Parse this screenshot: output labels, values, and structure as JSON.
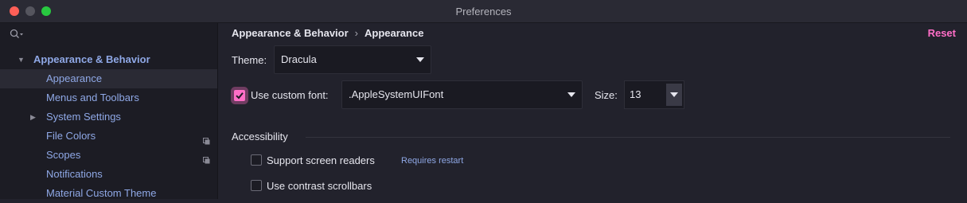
{
  "window": {
    "title": "Preferences"
  },
  "sidebar": {
    "search_placeholder": "",
    "items": [
      {
        "label": "Appearance & Behavior",
        "expanded": true
      },
      {
        "label": "Appearance",
        "selected": true
      },
      {
        "label": "Menus and Toolbars"
      },
      {
        "label": "System Settings",
        "collapsed": true
      },
      {
        "label": "File Colors"
      },
      {
        "label": "Scopes"
      },
      {
        "label": "Notifications"
      },
      {
        "label": "Material Custom Theme"
      }
    ]
  },
  "main": {
    "breadcrumb": {
      "parent": "Appearance & Behavior",
      "separator": "›",
      "current": "Appearance"
    },
    "reset_label": "Reset",
    "theme": {
      "label": "Theme:",
      "value": "Dracula"
    },
    "custom_font": {
      "label": "Use custom font:",
      "checked": true,
      "value": ".AppleSystemUIFont"
    },
    "size": {
      "label": "Size:",
      "value": "13"
    },
    "accessibility": {
      "title": "Accessibility",
      "screen_readers": {
        "label": "Support screen readers",
        "checked": false,
        "hint": "Requires restart"
      },
      "contrast_scrollbars": {
        "label": "Use contrast scrollbars",
        "checked": false
      }
    }
  },
  "colors": {
    "accent": "#ff6ec7",
    "link": "#8fa8e6",
    "background": "#22222c"
  }
}
